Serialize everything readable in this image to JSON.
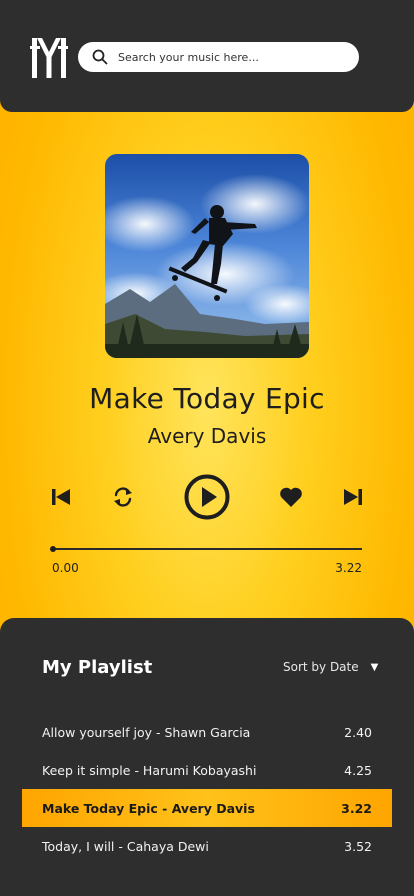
{
  "header": {
    "search_placeholder": "Search your music here..."
  },
  "now_playing": {
    "title": "Make Today Epic",
    "artist": "Avery Davis",
    "current_time": "0.00",
    "total_time": "3.22",
    "progress_fraction": 0.0
  },
  "playlist": {
    "title": "My Playlist",
    "sort_label": "Sort by Date",
    "tracks": [
      {
        "name": "Allow yourself joy - Shawn Garcia",
        "duration": "2.40"
      },
      {
        "name": "Keep it simple - Harumi Kobayashi",
        "duration": "4.25"
      },
      {
        "name": "Make Today Epic - Avery Davis",
        "duration": "3.22"
      },
      {
        "name": "Today, I will - Cahaya Dewi",
        "duration": "3.52"
      }
    ]
  },
  "colors": {
    "accent": "#ffb800",
    "dark": "#2e2e2e"
  }
}
